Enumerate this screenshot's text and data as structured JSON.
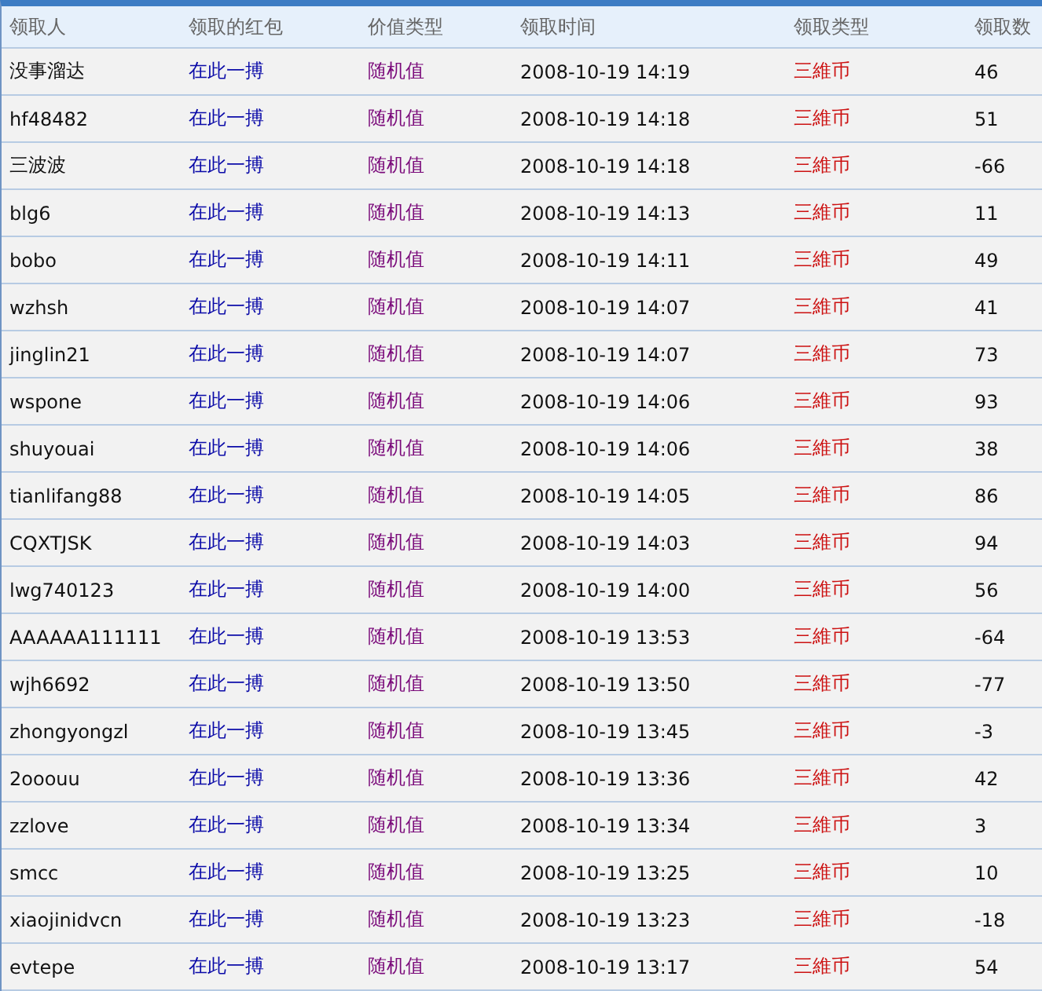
{
  "table": {
    "columns": [
      "领取人",
      "领取的红包",
      "价值类型",
      "领取时间",
      "领取类型",
      "领取数"
    ],
    "rows": [
      {
        "claimer": "没事溜达",
        "packet": "在此一搏",
        "value_type": "随机值",
        "time": "2008-10-19 14:19",
        "claim_type": "三維币",
        "amount": "46"
      },
      {
        "claimer": "hf48482",
        "packet": "在此一搏",
        "value_type": "随机值",
        "time": "2008-10-19 14:18",
        "claim_type": "三維币",
        "amount": "51"
      },
      {
        "claimer": "三波波",
        "packet": "在此一搏",
        "value_type": "随机值",
        "time": "2008-10-19 14:18",
        "claim_type": "三維币",
        "amount": "-66"
      },
      {
        "claimer": "blg6",
        "packet": "在此一搏",
        "value_type": "随机值",
        "time": "2008-10-19 14:13",
        "claim_type": "三維币",
        "amount": "11"
      },
      {
        "claimer": "bobo",
        "packet": "在此一搏",
        "value_type": "随机值",
        "time": "2008-10-19 14:11",
        "claim_type": "三維币",
        "amount": "49"
      },
      {
        "claimer": "wzhsh",
        "packet": "在此一搏",
        "value_type": "随机值",
        "time": "2008-10-19 14:07",
        "claim_type": "三維币",
        "amount": "41"
      },
      {
        "claimer": "jinglin21",
        "packet": "在此一搏",
        "value_type": "随机值",
        "time": "2008-10-19 14:07",
        "claim_type": "三維币",
        "amount": "73"
      },
      {
        "claimer": "wspone",
        "packet": "在此一搏",
        "value_type": "随机值",
        "time": "2008-10-19 14:06",
        "claim_type": "三維币",
        "amount": "93"
      },
      {
        "claimer": "shuyouai",
        "packet": "在此一搏",
        "value_type": "随机值",
        "time": "2008-10-19 14:06",
        "claim_type": "三維币",
        "amount": "38"
      },
      {
        "claimer": "tianlifang88",
        "packet": "在此一搏",
        "value_type": "随机值",
        "time": "2008-10-19 14:05",
        "claim_type": "三維币",
        "amount": "86"
      },
      {
        "claimer": "CQXTJSK",
        "packet": "在此一搏",
        "value_type": "随机值",
        "time": "2008-10-19 14:03",
        "claim_type": "三維币",
        "amount": "94"
      },
      {
        "claimer": "lwg740123",
        "packet": "在此一搏",
        "value_type": "随机值",
        "time": "2008-10-19 14:00",
        "claim_type": "三維币",
        "amount": "56"
      },
      {
        "claimer": "AAAAAA111111",
        "packet": "在此一搏",
        "value_type": "随机值",
        "time": "2008-10-19 13:53",
        "claim_type": "三維币",
        "amount": "-64"
      },
      {
        "claimer": "wjh6692",
        "packet": "在此一搏",
        "value_type": "随机值",
        "time": "2008-10-19 13:50",
        "claim_type": "三維币",
        "amount": "-77"
      },
      {
        "claimer": "zhongyongzl",
        "packet": "在此一搏",
        "value_type": "随机值",
        "time": "2008-10-19 13:45",
        "claim_type": "三維币",
        "amount": "-3"
      },
      {
        "claimer": "2ooouu",
        "packet": "在此一搏",
        "value_type": "随机值",
        "time": "2008-10-19 13:36",
        "claim_type": "三維币",
        "amount": "42"
      },
      {
        "claimer": "zzlove",
        "packet": "在此一搏",
        "value_type": "随机值",
        "time": "2008-10-19 13:34",
        "claim_type": "三維币",
        "amount": "3"
      },
      {
        "claimer": "smcc",
        "packet": "在此一搏",
        "value_type": "随机值",
        "time": "2008-10-19 13:25",
        "claim_type": "三維币",
        "amount": "10"
      },
      {
        "claimer": "xiaojinidvcn",
        "packet": "在此一搏",
        "value_type": "随机值",
        "time": "2008-10-19 13:23",
        "claim_type": "三維币",
        "amount": "-18"
      },
      {
        "claimer": "evtepe",
        "packet": "在此一搏",
        "value_type": "随机值",
        "time": "2008-10-19 13:17",
        "claim_type": "三維币",
        "amount": "54"
      }
    ]
  }
}
